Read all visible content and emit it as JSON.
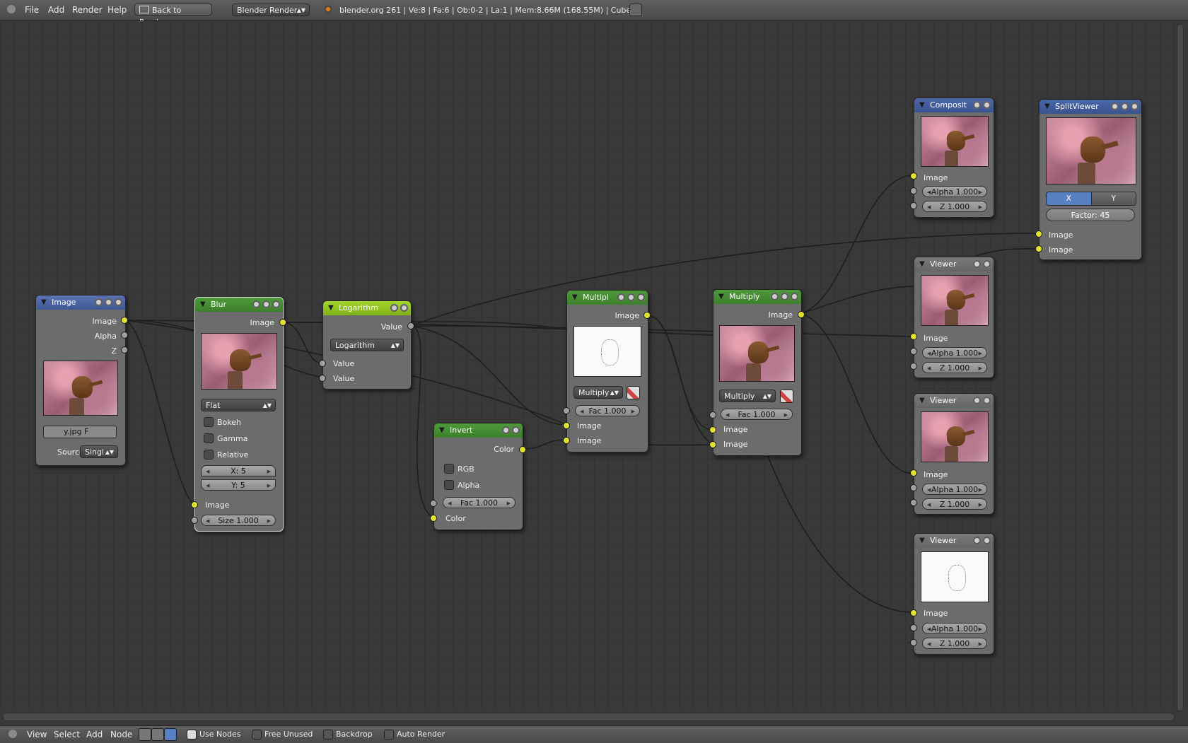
{
  "top": {
    "menu": [
      "File",
      "Add",
      "Render",
      "Help"
    ],
    "back_button": "Back to Previous",
    "engine": "Blender Render",
    "info": "blender.org 261 | Ve:8 | Fa:6 | Ob:0-2 | La:1 | Mem:8.66M (168.55M) | Cube"
  },
  "nodes": {
    "image": {
      "title": "Image",
      "outputs": [
        "Image",
        "Alpha",
        "Z"
      ],
      "file": "y.jpg",
      "file_flag": "F",
      "source_label": "Source:",
      "source_value": "Singl"
    },
    "blur": {
      "title": "Blur",
      "output": "Image",
      "filter": "Flat",
      "checks": [
        "Bokeh",
        "Gamma",
        "Relative"
      ],
      "x": "X: 5",
      "y": "Y: 5",
      "input": "Image",
      "size": "Size 1.000"
    },
    "log": {
      "title": "Logarithm",
      "output": "Value",
      "op": "Logarithm",
      "inputs": [
        "Value",
        "Value"
      ]
    },
    "invert": {
      "title": "Invert",
      "output": "Color",
      "checks": [
        "RGB",
        "Alpha"
      ],
      "fac": "Fac 1.000",
      "input": "Color"
    },
    "mul1": {
      "title": "Multipl",
      "output": "Image",
      "blend": "Multiply",
      "fac": "Fac 1.000",
      "inputs": [
        "Image",
        "Image"
      ]
    },
    "mul2": {
      "title": "Multiply",
      "output": "Image",
      "blend": "Multiply",
      "fac": "Fac 1.000",
      "inputs": [
        "Image",
        "Image"
      ]
    },
    "composite": {
      "title": "Composit",
      "input": "Image",
      "alpha": "Alpha 1.000",
      "z": "Z 1.000"
    },
    "splitviewer": {
      "title": "SplitViewer",
      "axis_x": "X",
      "axis_y": "Y",
      "factor": "Factor: 45",
      "inputs": [
        "Image",
        "Image"
      ]
    },
    "viewer1": {
      "title": "Viewer",
      "input": "Image",
      "alpha": "Alpha 1.000",
      "z": "Z 1.000"
    },
    "viewer2": {
      "title": "Viewer",
      "input": "Image",
      "alpha": "Alpha 1.000",
      "z": "Z 1.000"
    },
    "viewer3": {
      "title": "Viewer",
      "input": "Image",
      "alpha": "Alpha 1.000",
      "z": "Z 1.000"
    }
  },
  "bottom": {
    "menu": [
      "View",
      "Select",
      "Add",
      "Node"
    ],
    "use_nodes": "Use Nodes",
    "free_unused": "Free Unused",
    "backdrop": "Backdrop",
    "auto_render": "Auto Render"
  },
  "colors": {
    "input_header": "#4b66a8",
    "filter_header": "#4e9a3b",
    "converter_header": "#a4d42a",
    "image_socket": "#e2e231",
    "value_socket": "#a0a0a0"
  }
}
